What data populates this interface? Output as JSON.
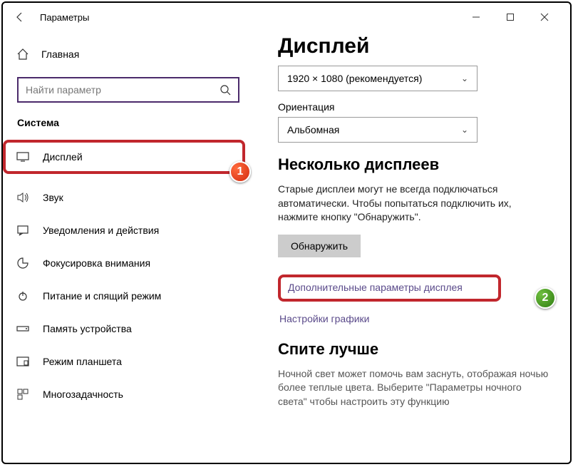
{
  "titlebar": {
    "title": "Параметры"
  },
  "sidebar": {
    "home": "Главная",
    "search_placeholder": "Найти параметр",
    "category": "Система",
    "items": [
      {
        "label": "Дисплей"
      },
      {
        "label": "Звук"
      },
      {
        "label": "Уведомления и действия"
      },
      {
        "label": "Фокусировка внимания"
      },
      {
        "label": "Питание и спящий режим"
      },
      {
        "label": "Память устройства"
      },
      {
        "label": "Режим планшета"
      },
      {
        "label": "Многозадачность"
      }
    ]
  },
  "content": {
    "heading": "Дисплей",
    "resolution_value": "1920 × 1080 (рекомендуется)",
    "orientation_label": "Ориентация",
    "orientation_value": "Альбомная",
    "multi_heading": "Несколько дисплеев",
    "multi_desc": "Старые дисплеи могут не всегда подключаться автоматически. Чтобы попытаться подключить их, нажмите кнопку \"Обнаружить\".",
    "detect_btn": "Обнаружить",
    "adv_link": "Дополнительные параметры дисплея",
    "gfx_link": "Настройки графики",
    "sleep_heading": "Спите лучше",
    "sleep_desc": "Ночной свет может помочь вам заснуть, отображая ночью более теплые цвета. Выберите \"Параметры ночного света\" чтобы настроить эту функцию"
  },
  "badges": {
    "one": "1",
    "two": "2"
  }
}
